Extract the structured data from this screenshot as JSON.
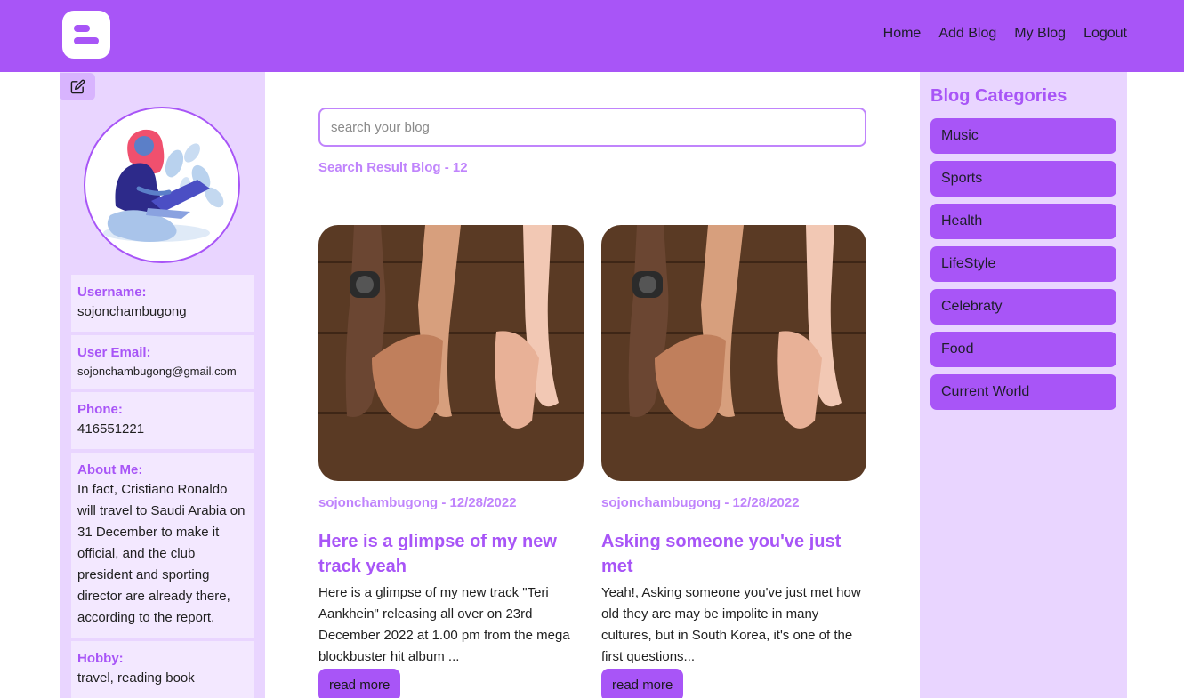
{
  "colors": {
    "brand": "#a855f7",
    "sidebar_bg": "#e9d5ff",
    "card_bg": "#f3e8ff",
    "accent_light": "#c084fc"
  },
  "header": {
    "logo_icon": "blogger-logo-icon",
    "nav": [
      "Home",
      "Add Blog",
      "My Blog",
      "Logout"
    ]
  },
  "profile": {
    "edit_icon": "edit-icon",
    "avatar": "woman-with-laptop-illustration",
    "fields": [
      {
        "label": "Username:",
        "value": "sojonchambugong"
      },
      {
        "label": "User Email:",
        "value": "sojonchambugong@gmail.com"
      },
      {
        "label": "Phone:",
        "value": "416551221"
      },
      {
        "label": "About Me:",
        "value": "In fact, Cristiano Ronaldo will travel to Saudi Arabia on 31 December to make it official, and the club president and sporting director are already there, according to the report."
      },
      {
        "label": "Hobby:",
        "value": "travel, reading book"
      }
    ]
  },
  "search": {
    "placeholder": "search your blog",
    "value": "",
    "result_text": "Search Result Blog - 12"
  },
  "posts": [
    {
      "author_date": "sojonchambugong - 12/28/2022",
      "title": "Here is a glimpse of my new track yeah",
      "excerpt": "Here is a glimpse of my new track \"Teri Aankhein\" releasing all over on 23rd December 2022 at 1.00 pm from the mega blockbuster hit album ...",
      "button": "read more"
    },
    {
      "author_date": "sojonchambugong - 12/28/2022",
      "title": "Asking someone you've just met",
      "excerpt": "Yeah!, Asking someone you've just met how old they are may be impolite in many cultures, but in South Korea, it's one of the first questions...",
      "button": "read more"
    }
  ],
  "categories": {
    "title": "Blog Categories",
    "items": [
      "Music",
      "Sports",
      "Health",
      "LifeStyle",
      "Celebraty",
      "Food",
      "Current World"
    ]
  }
}
